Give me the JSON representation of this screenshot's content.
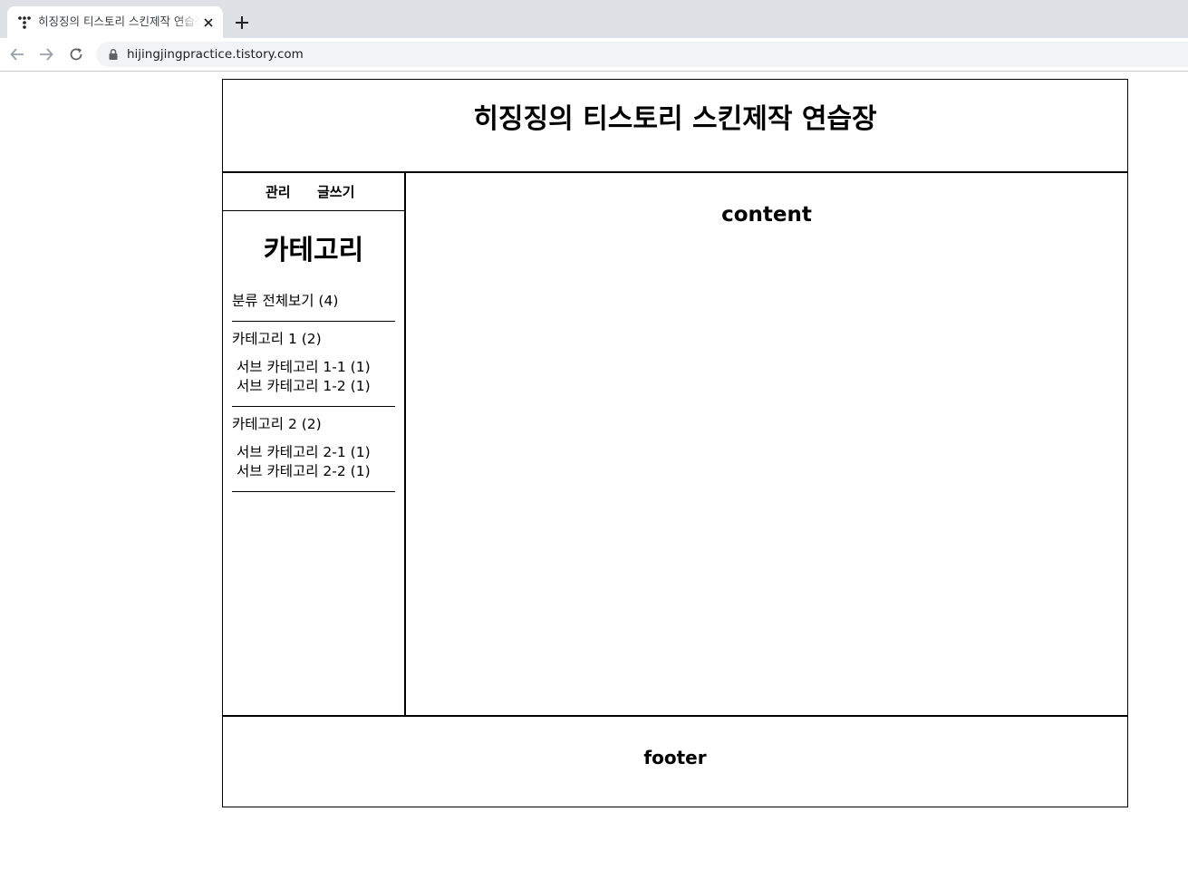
{
  "browser": {
    "tab": {
      "title": "히징징의 티스토리 스킨제작 연습장",
      "favicon": "tistory-icon",
      "close_icon": "close-icon"
    },
    "new_tab_icon": "plus-icon",
    "nav": {
      "back_icon": "arrow-left-icon",
      "forward_icon": "arrow-right-icon",
      "reload_icon": "reload-icon"
    },
    "address_bar": {
      "lock_icon": "lock-icon",
      "url": "hijingjingpractice.tistory.com"
    }
  },
  "page": {
    "header": {
      "title": "히징징의 티스토리 스킨제작 연습장"
    },
    "sidebar": {
      "admin_links": {
        "manage": "관리",
        "write": "글쓰기"
      },
      "category_heading": "카테고리",
      "all_posts": "분류 전체보기 (4)",
      "categories": [
        {
          "label": "카테고리 1 (2)",
          "subcategories": [
            "서브 카테고리 1-1 (1)",
            "서브 카테고리 1-2 (1)"
          ]
        },
        {
          "label": "카테고리 2 (2)",
          "subcategories": [
            "서브 카테고리 2-1 (1)",
            "서브 카테고리 2-2 (1)"
          ]
        }
      ]
    },
    "content": {
      "title": "content"
    },
    "footer": {
      "text": "footer"
    }
  },
  "colors": {
    "tabstrip": "#dee1e6",
    "omnibox": "#f1f3f4",
    "border": "#000000"
  }
}
